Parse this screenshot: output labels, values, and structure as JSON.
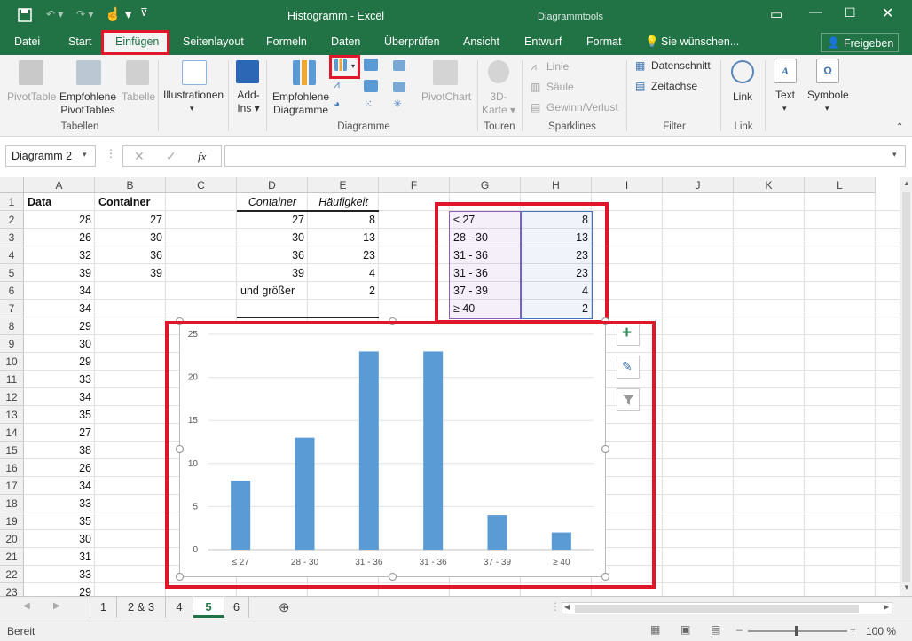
{
  "title": "Histogramm - Excel",
  "context_tab": "Diagrammtools",
  "tabs": [
    {
      "label": "Datei"
    },
    {
      "label": "Start"
    },
    {
      "label": "Einfügen"
    },
    {
      "label": "Seitenlayout"
    },
    {
      "label": "Formeln"
    },
    {
      "label": "Daten"
    },
    {
      "label": "Überprüfen"
    },
    {
      "label": "Ansicht"
    },
    {
      "label": "Entwurf"
    },
    {
      "label": "Format"
    },
    {
      "label": "Sie wünschen..."
    }
  ],
  "share_label": "Freigeben",
  "ribbon": {
    "pivottable": "PivotTable",
    "empfohlene_pivot_1": "Empfohlene",
    "empfohlene_pivot_2": "PivotTables",
    "tabelle": "Tabelle",
    "illustrationen": "Illustrationen",
    "addins_1": "Add-",
    "addins_2": "Ins",
    "empf_diagramme_1": "Empfohlene",
    "empf_diagramme_2": "Diagramme",
    "pivotchart": "PivotChart",
    "karte_1": "3D-",
    "karte_2": "Karte",
    "linie": "Linie",
    "saeule": "Säule",
    "gewinn": "Gewinn/Verlust",
    "datenschnitt": "Datenschnitt",
    "zeitachse": "Zeitachse",
    "link": "Link",
    "text": "Text",
    "symbole": "Symbole",
    "groups": {
      "tabellen": "Tabellen",
      "diagramme": "Diagramme",
      "touren": "Touren",
      "sparklines": "Sparklines",
      "filter": "Filter",
      "link": "Link"
    }
  },
  "formula_bar": {
    "name_box": "Diagramm 2",
    "fx": "fx",
    "value": ""
  },
  "columns": [
    "A",
    "B",
    "C",
    "D",
    "E",
    "F",
    "G",
    "H",
    "I",
    "J",
    "K",
    "L"
  ],
  "rows": [
    "1",
    "2",
    "3",
    "4",
    "5",
    "6",
    "7",
    "8",
    "9",
    "10",
    "11",
    "12",
    "13",
    "14",
    "15",
    "16",
    "17",
    "18",
    "19",
    "20",
    "21",
    "22",
    "23"
  ],
  "cells": {
    "A1": "Data",
    "B1": "Container",
    "D1": "Container",
    "E1": "Häufigkeit",
    "A2": "28",
    "A3": "26",
    "A4": "32",
    "A5": "39",
    "A6": "34",
    "A7": "34",
    "A8": "29",
    "A9": "30",
    "A10": "29",
    "A11": "33",
    "A12": "34",
    "A13": "35",
    "A14": "27",
    "A15": "38",
    "A16": "26",
    "A17": "34",
    "A18": "33",
    "A19": "35",
    "A20": "30",
    "A21": "31",
    "A22": "33",
    "A23": "29",
    "B2": "27",
    "B3": "30",
    "B4": "36",
    "B5": "39",
    "D2": "27",
    "D3": "30",
    "D4": "36",
    "D5": "39",
    "D6": "und größer",
    "E2": "8",
    "E3": "13",
    "E4": "23",
    "E5": "4",
    "E6": "2",
    "G2": "≤ 27",
    "G3": "28 - 30",
    "G4": "31 - 36",
    "G5": "31 - 36",
    "G6": "37 - 39",
    "G7": "≥ 40",
    "H2": "8",
    "H3": "13",
    "H4": "23",
    "H5": "23",
    "H6": "4",
    "H7": "2"
  },
  "chart_data": {
    "type": "bar",
    "categories": [
      "≤ 27",
      "28 - 30",
      "31 - 36",
      "31 - 36",
      "37 - 39",
      "≥ 40"
    ],
    "values": [
      8,
      13,
      23,
      23,
      4,
      2
    ],
    "ylim": [
      0,
      25
    ],
    "yticks": [
      "0",
      "5",
      "10",
      "15",
      "20",
      "25"
    ],
    "color": "#5b9bd5",
    "grid": true
  },
  "sheets": [
    "1",
    "2 & 3",
    "4",
    "5",
    "6"
  ],
  "active_sheet": "5",
  "status": {
    "ready": "Bereit",
    "zoom": "100 %"
  },
  "colors": {
    "excel_green": "#217346",
    "highlight_red": "#e0162b",
    "bar_blue": "#5b9bd5"
  }
}
